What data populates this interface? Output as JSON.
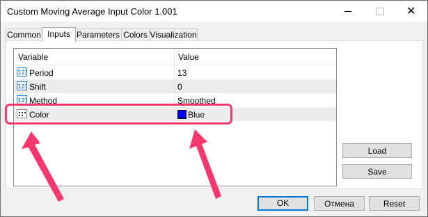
{
  "window": {
    "title": "Custom Moving Average Input Color 1.001"
  },
  "tabs": [
    {
      "label": "Common"
    },
    {
      "label": "Inputs"
    },
    {
      "label": "Parameters"
    },
    {
      "label": "Colors"
    },
    {
      "label": "Visualization"
    }
  ],
  "active_tab": "Inputs",
  "grid": {
    "columns": [
      "Variable",
      "Value"
    ],
    "rows": [
      {
        "variable": "Period",
        "value": "13",
        "icon": "numeric-123-icon"
      },
      {
        "variable": "Shift",
        "value": "0",
        "icon": "numeric-123-icon"
      },
      {
        "variable": "Method",
        "value": "Smoothed",
        "icon": "numeric-123-icon"
      },
      {
        "variable": "Color",
        "value": "Blue",
        "icon": "color-grid-icon",
        "swatch": "#0000ff"
      }
    ]
  },
  "side_buttons": {
    "load": "Load",
    "save": "Save"
  },
  "footer_buttons": {
    "ok": "OK",
    "cancel": "Отмена",
    "reset": "Reset"
  },
  "colors": {
    "annotation": "#f6386f",
    "ok_border": "#0078d7"
  }
}
